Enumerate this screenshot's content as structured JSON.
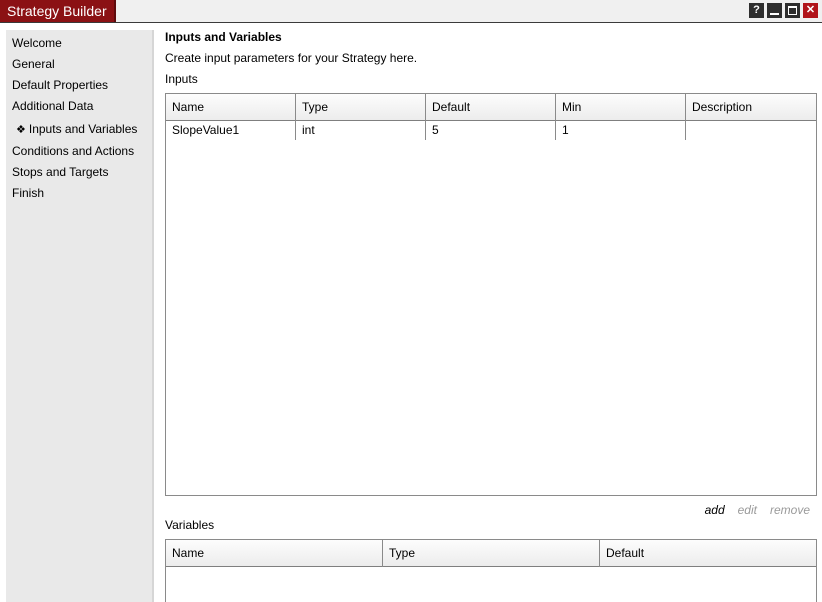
{
  "window": {
    "title": "Strategy Builder",
    "controls": {
      "help": "?",
      "close": "✕"
    }
  },
  "sidebar": {
    "items": [
      {
        "label": "Welcome"
      },
      {
        "label": "General"
      },
      {
        "label": "Default Properties"
      },
      {
        "label": "Additional Data"
      },
      {
        "label": "Inputs and Variables",
        "marker": "❖",
        "current": true
      },
      {
        "label": "Conditions and Actions"
      },
      {
        "label": "Stops and Targets"
      },
      {
        "label": "Finish"
      }
    ]
  },
  "page": {
    "heading": "Inputs and Variables",
    "description": "Create input parameters for your Strategy here."
  },
  "inputs": {
    "label": "Inputs",
    "columns": [
      "Name",
      "Type",
      "Default",
      "Min",
      "Description"
    ],
    "rows": [
      [
        "SlopeValue1",
        "int",
        "5",
        "1",
        ""
      ]
    ],
    "actions": {
      "add": "add",
      "edit": "edit",
      "remove": "remove"
    }
  },
  "variables": {
    "label": "Variables",
    "columns": [
      "Name",
      "Type",
      "Default"
    ],
    "rows": []
  },
  "colors": {
    "title_tab": "#8b1114",
    "sidebar_bg": "#e9e9e9",
    "grid_border": "#8a8a8a",
    "disabled_text": "#9a9a9a"
  },
  "icons": {
    "help": "help-icon",
    "minimize": "minimize-icon",
    "maximize": "maximize-icon",
    "close": "close-icon",
    "current_marker": "diamond-bullet-icon"
  }
}
